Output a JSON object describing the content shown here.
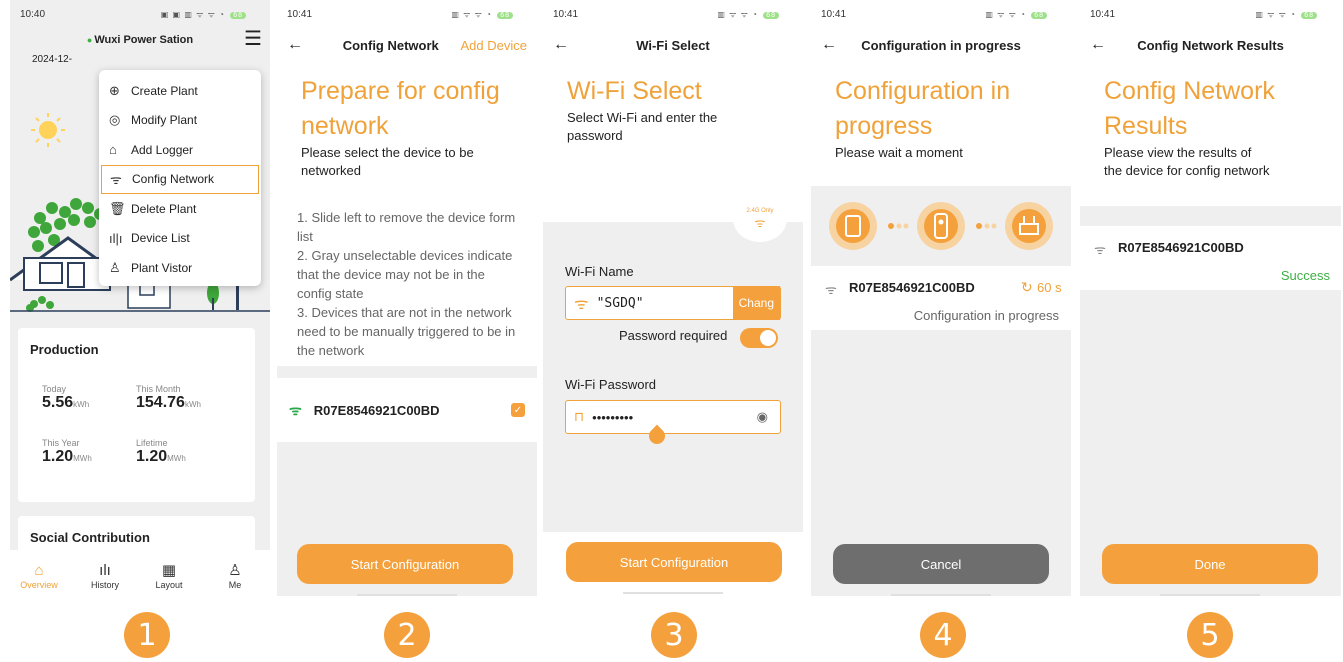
{
  "steps": [
    "1",
    "2",
    "3",
    "4",
    "5"
  ],
  "s1": {
    "time": "10:40",
    "plant_name": "Wuxi Power Sation",
    "date": "2024-12-",
    "menu": [
      "Create Plant",
      "Modify Plant",
      "Add Logger",
      "Config Network",
      "Delete Plant",
      "Device List",
      "Plant Vistor"
    ],
    "production_title": "Production",
    "today_label": "Today",
    "today_value": "5.56",
    "today_unit": "kWh",
    "month_label": "This Month",
    "month_value": "154.76",
    "month_unit": "kWh",
    "year_label": "This Year",
    "year_value": "1.20",
    "year_unit": "MWh",
    "lifetime_label": "Lifetime",
    "lifetime_value": "1.20",
    "lifetime_unit": "MWh",
    "social_title": "Social Contribution",
    "tabs": [
      "Overview",
      "History",
      "Layout",
      "Me"
    ]
  },
  "s2": {
    "time": "10:41",
    "title": "Config Network",
    "action": "Add Device",
    "heading1": "Prepare for config",
    "heading2": "network",
    "subtitle": "Please select the device to be networked",
    "instructions": "1. Slide left to remove the device form list\n2. Gray unselectable devices indicate that the device may not be in the config state\n3. Devices that are not in the network need to be manually triggered to be in the network",
    "device": "R07E8546921C00BD",
    "button": "Start Configuration"
  },
  "s3": {
    "time": "10:41",
    "title": "Wi-Fi Select",
    "heading": "Wi-Fi Select",
    "subtitle": "Select Wi-Fi and enter the password",
    "badge": "2.4G Only",
    "wifi_name_label": "Wi-Fi Name",
    "wifi_name_value": "\"SGDQ\"",
    "change_btn": "Chang",
    "password_required": "Password required",
    "wifi_password_label": "Wi-Fi Password",
    "wifi_password_value": "•••••••••",
    "button": "Start Configuration"
  },
  "s4": {
    "time": "10:41",
    "title": "Configuration in progress",
    "heading1": "Configuration in",
    "heading2": "progress",
    "subtitle": "Please wait a moment",
    "device": "R07E8546921C00BD",
    "countdown": "60 s",
    "status": "Configuration in progress",
    "button": "Cancel"
  },
  "s5": {
    "time": "10:41",
    "title": "Config Network Results",
    "heading1": "Config Network",
    "heading2": "Results",
    "subtitle": "Please view the results of the device for config network",
    "device": "R07E8546921C00BD",
    "result": "Success",
    "button": "Done"
  },
  "colors": {
    "accent": "#f4a13d",
    "success": "#3cb043",
    "wifi": "#29a84a"
  }
}
